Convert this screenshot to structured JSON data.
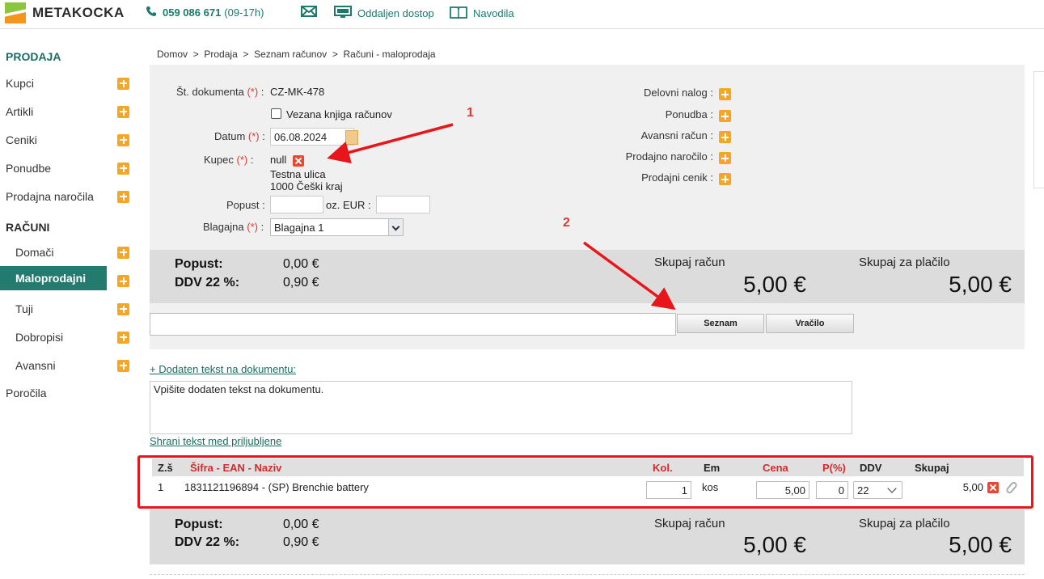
{
  "topbar": {
    "logo_text": "METAKOCKA",
    "phone": "059 086 671",
    "phone_hours": "(09-17h)",
    "remote_label": "Oddaljen dostop",
    "guide_label": "Navodila",
    "icons": [
      "phone-icon",
      "mail-icon",
      "monitor-icon",
      "book-icon"
    ]
  },
  "sidebar": {
    "section1": "PRODAJA",
    "items1": [
      {
        "label": "Kupci"
      },
      {
        "label": "Artikli"
      },
      {
        "label": "Ceniki"
      },
      {
        "label": "Ponudbe"
      },
      {
        "label": "Prodajna naročila"
      }
    ],
    "section2": "RAČUNI",
    "items2": [
      {
        "label": "Domači"
      },
      {
        "label": "Maloprodajni"
      },
      {
        "label": "Tuji"
      },
      {
        "label": "Dobropisi"
      },
      {
        "label": "Avansni"
      }
    ],
    "reports": "Poročila"
  },
  "breadcrumb": {
    "home": "Domov",
    "sales": "Prodaja",
    "list": "Seznam računov",
    "current": "Računi - maloprodaja",
    "sep": ">"
  },
  "form": {
    "doc_label": "Št. dokumenta",
    "doc_value": "CZ-MK-478",
    "linked_label": "Vezana knjiga računov",
    "date_label": "Datum",
    "date_value": "06.08.2024",
    "buyer_label": "Kupec",
    "buyer_value": "null",
    "buyer_street": "Testna ulica",
    "buyer_city": "1000 Češki kraj",
    "discount_label": "Popust :",
    "discount_or": "oz. EUR :",
    "register_label": "Blagajna",
    "register_value": "Blagajna 1",
    "req_mark": "(*)",
    "colon": ":"
  },
  "links_right": [
    {
      "label": "Delovni nalog :"
    },
    {
      "label": "Ponudba :"
    },
    {
      "label": "Avansni račun :"
    },
    {
      "label": "Prodajno naročilo :"
    },
    {
      "label": "Prodajni cenik :"
    }
  ],
  "totals": {
    "discount_label": "Popust:",
    "discount_value": "0,00 €",
    "vat_label": "DDV 22 %:",
    "vat_value": "0,90 €",
    "invoice_label": "Skupaj račun",
    "invoice_value": "5,00 €",
    "pay_label": "Skupaj za plačilo",
    "pay_value": "5,00 €"
  },
  "buttons": {
    "list": "Seznam",
    "refund": "Vračilo"
  },
  "extra_text": {
    "toggle": "+ Dodaten tekst na dokumentu:",
    "placeholder": "Vpišite dodaten tekst na dokumentu.",
    "save_fav": "Shrani tekst med priljubljene"
  },
  "table": {
    "headers": {
      "no": "Z.š",
      "code": "Šifra - EAN - Naziv",
      "qty": "Kol.",
      "unit": "Em",
      "price": "Cena",
      "disc": "P(%)",
      "vat": "DDV",
      "total": "Skupaj"
    },
    "rows": [
      {
        "no": "1",
        "ean": "1831121196894",
        "name": "- (SP) Brenchie battery",
        "qty": "1",
        "unit": "kos",
        "price": "5,00",
        "disc": "0",
        "vat": "22",
        "total": "5,00"
      }
    ]
  },
  "annotations": {
    "one": "1",
    "two": "2",
    "arrow_color": "#e8161b"
  },
  "colors": {
    "accent": "#237a6e",
    "plus": "#f5a623",
    "required": "#e03a2f"
  }
}
